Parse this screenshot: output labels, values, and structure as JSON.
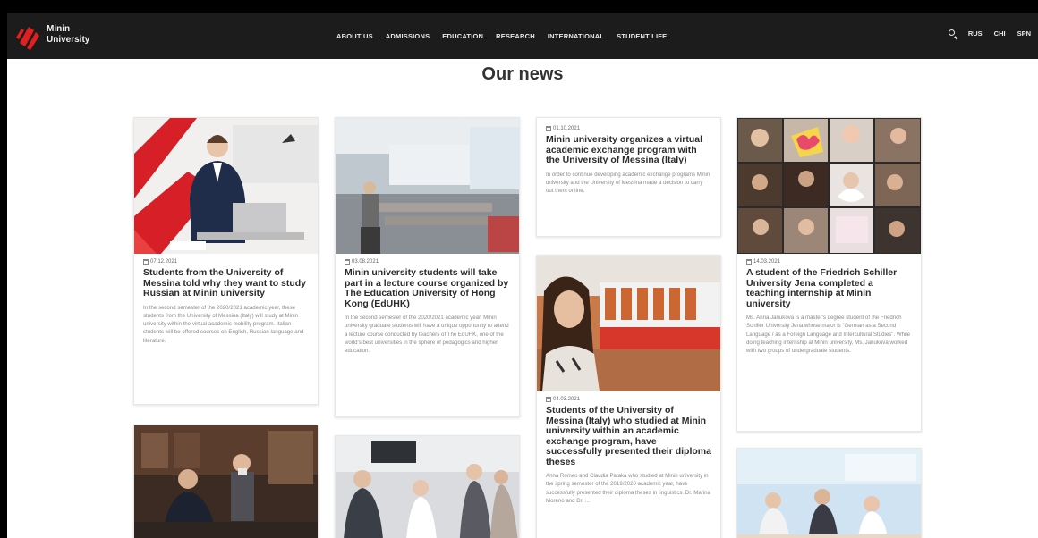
{
  "brand": {
    "logo_text": "Minin\nUniversity"
  },
  "nav": [
    "ABOUT US",
    "ADMISSIONS",
    "EDUCATION",
    "RESEARCH",
    "INTERNATIONAL",
    "STUDENT LIFE"
  ],
  "lang": [
    "RUS",
    "CHI",
    "SPN"
  ],
  "page": {
    "title": "Our news"
  },
  "cards": [
    {
      "date": "07.12.2021",
      "title": "Students from the University of Messina told why they want to study Russian at Minin university",
      "excerpt": "In the second semester of the 2020/2021 academic year, these students from the University of Messina (Italy) will study at Minin university within the virtual academic mobility program. Italian students will be offered courses on English, Russian language and literature."
    },
    {
      "date": "03.08.2021",
      "title": "Minin university students will take part in a lecture course organized by The Education University of Hong Kong (EdUHK)",
      "excerpt": "In the second semester of the 2020/2021 academic year, Minin university graduate students will have a unique opportunity to attend a lecture course conducted by teachers of The EdUHK, one of the world's best universities in the sphere of pedagogics and higher education."
    },
    {
      "date": "01.10.2021",
      "title": "Minin university organizes a virtual academic exchange program with the University of Messina (Italy)",
      "excerpt": "In order to continue developing academic exchange programs Minin university and the University of Messina made a decision to carry out them online."
    },
    {
      "date": "04.03.2021",
      "title": "Students of the University of Messina (Italy) who studied at Minin university within an academic exchange program, have successfully presented their diploma theses",
      "excerpt": "Anna Romeo and Claudia Pataka who studied at Minin university in the spring semester of the 2019/2020 academic year, have successfully presented their diploma theses in linguistics. Dr. Marina Moreno and Dr. ..."
    },
    {
      "date": "14.03.2021",
      "title": "A student of the Friedrich Schiller University Jena completed a teaching internship at Minin university",
      "excerpt": "Ms. Anna Janukova is a master's degree student of the Friedrich Schiller University Jena whose major is \"German as a Second Language / as a Foreign Language and Intercultural Studies\". While doing teaching internship at Minin university, Ms. Janukova worked with two groups of undergraduate students."
    }
  ]
}
